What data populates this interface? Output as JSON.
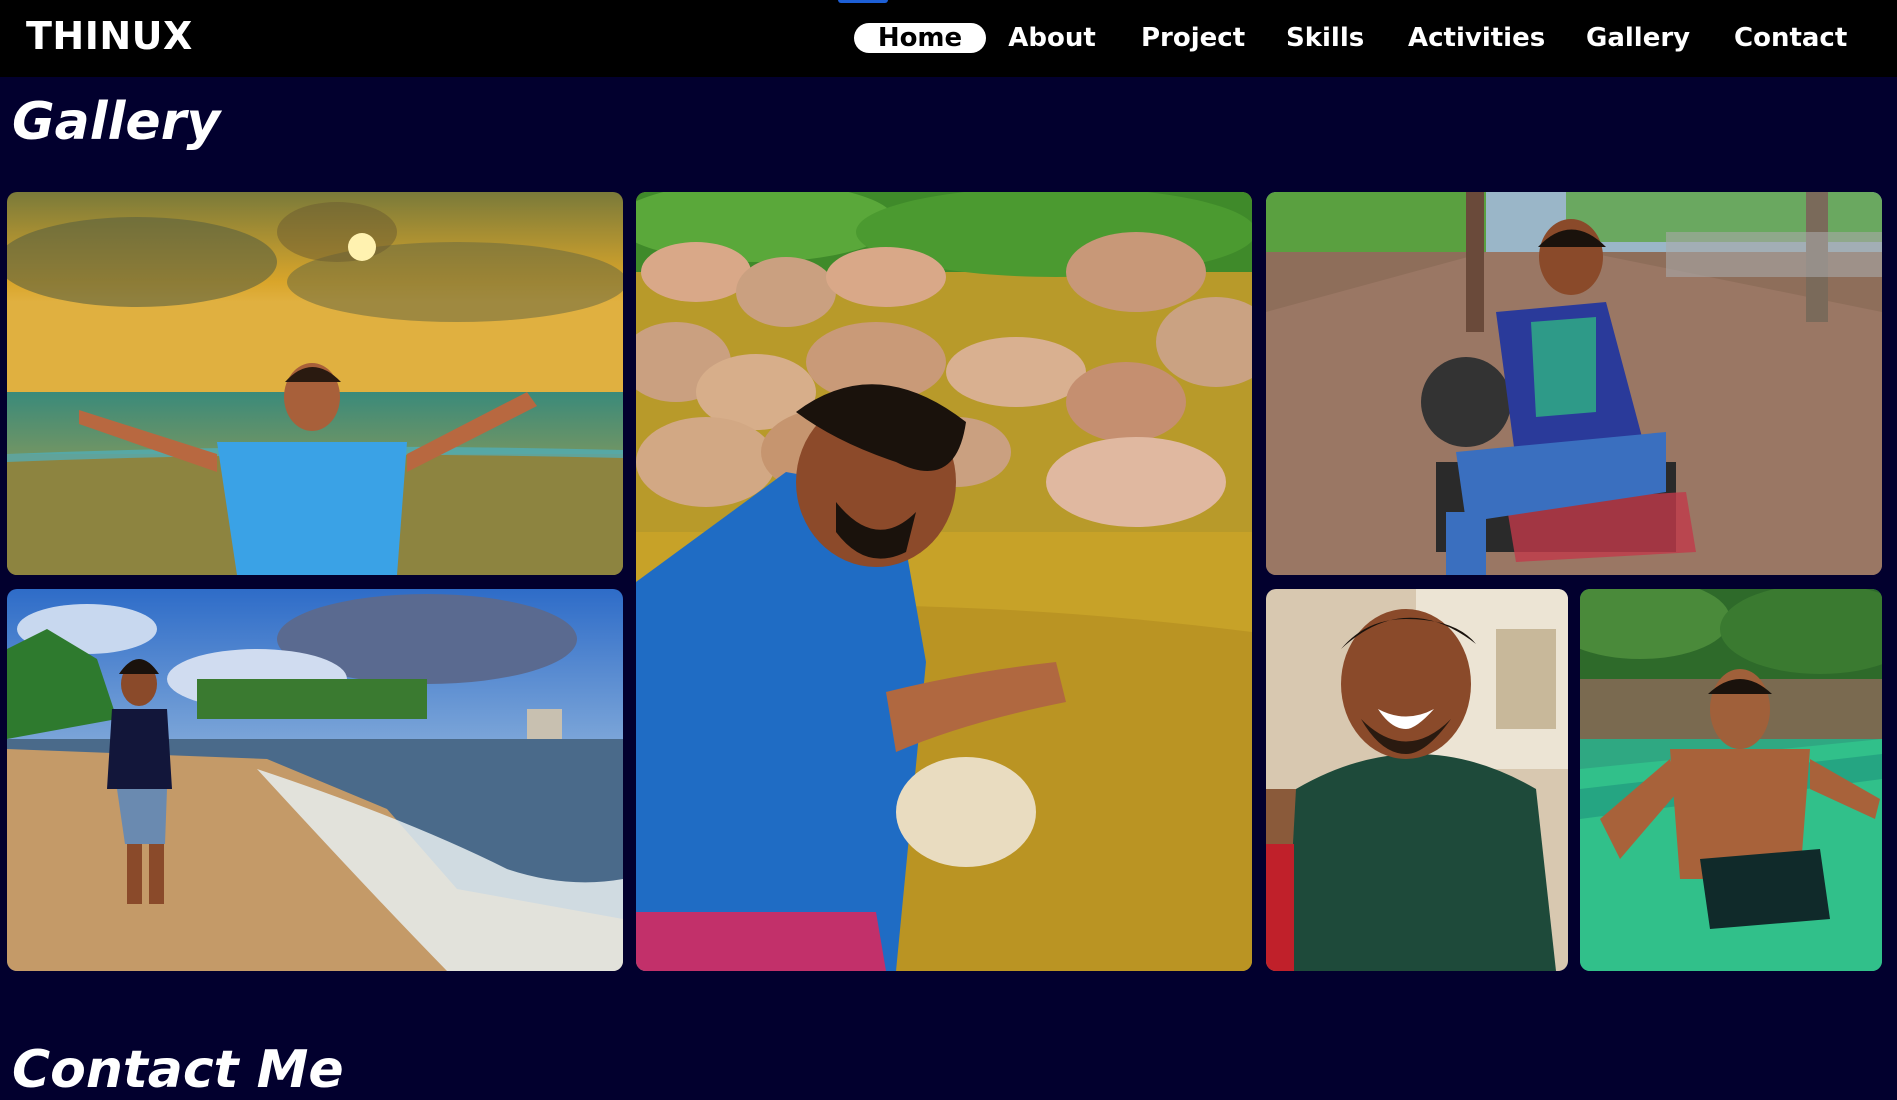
{
  "brand": "THINUX",
  "nav": [
    "Home",
    "About",
    "Project",
    "Skills",
    "Activities",
    "Gallery",
    "Contact"
  ],
  "gallery": {
    "title": "Gallery"
  },
  "contact": {
    "title": "Contact Me"
  },
  "colors": {
    "page_bg": "#02002e",
    "nav_bg": "#000000",
    "active_pill": "#ffffff",
    "indicator": "#1d5fd6"
  },
  "photos": [
    "beach-sunset-arms-open",
    "river-rocks-blue-tank",
    "street-motorbike",
    "beach-walk-waves",
    "smiling-indoor",
    "pool-swim"
  ]
}
